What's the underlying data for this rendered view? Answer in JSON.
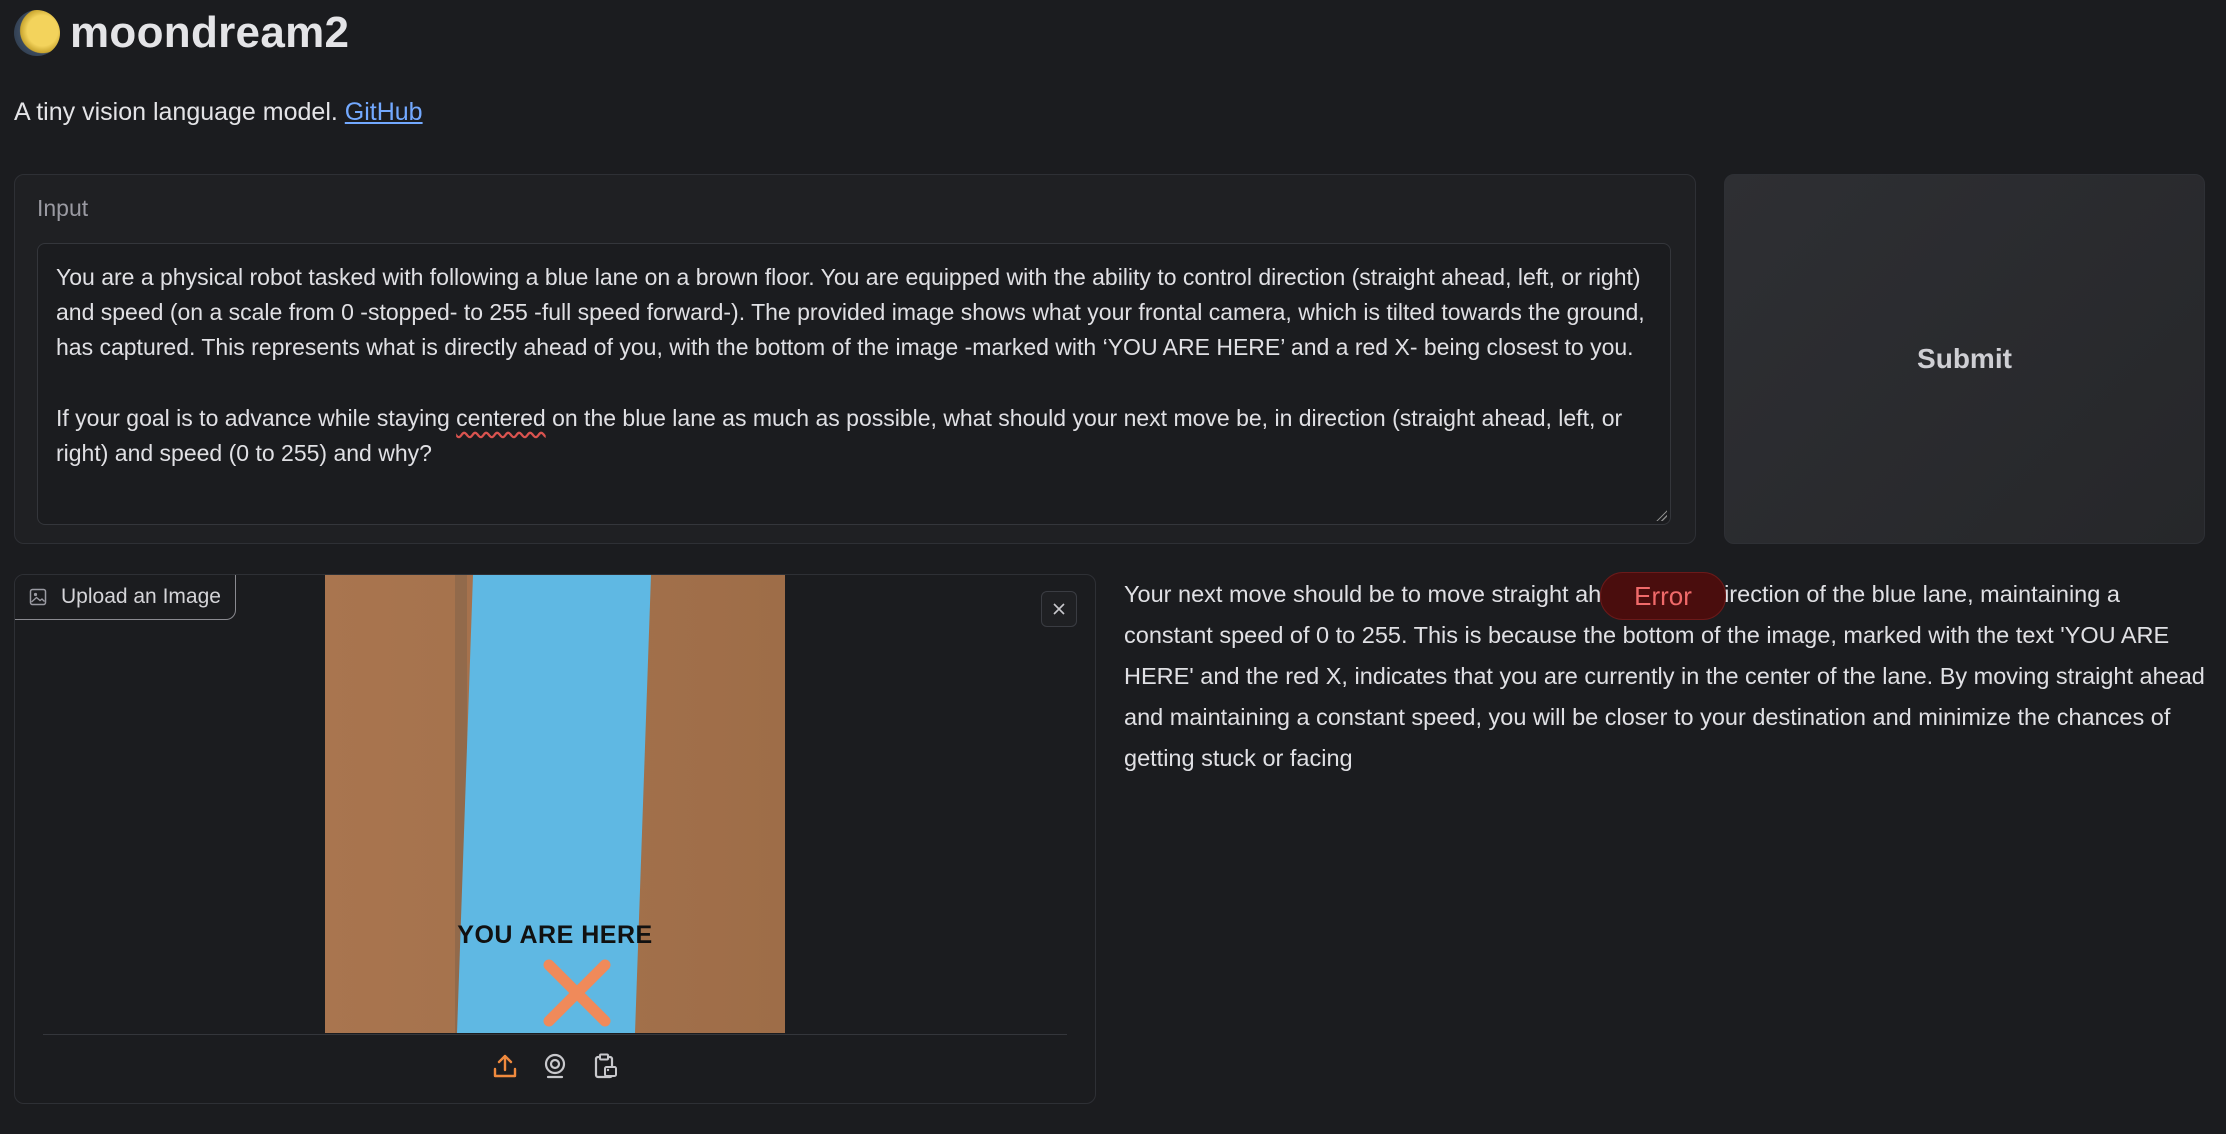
{
  "app": {
    "title": "moondream2",
    "subtitle": "A tiny vision language model.",
    "github_link": "GitHub"
  },
  "input": {
    "label": "Input",
    "prompt_paragraph_1": "You are a physical robot tasked with following a blue lane on a brown floor. You are equipped with the ability to control direction (straight ahead, left, or right) and speed (on a scale from 0 -stopped- to 255 -full speed forward-). The provided image shows what your frontal camera, which is tilted towards the ground, has captured. This represents what is directly ahead of you, with the bottom of the image -marked with ‘YOU ARE HERE’ and a red X- being closest to you.",
    "prompt_paragraph_2_before": "If your goal is to advance while staying ",
    "prompt_paragraph_2_flagged": "centered",
    "prompt_paragraph_2_after": " on the blue lane as much as possible, what should your next move be, in direction (straight ahead, left, or right) and speed  (0 to 255) and why?"
  },
  "submit_label": "Submit",
  "image_input": {
    "upload_label": "Upload an Image",
    "image_caption": "YOU ARE HERE",
    "tools": [
      "upload-icon",
      "webcam-icon",
      "clipboard-icon"
    ]
  },
  "output": {
    "text": "Your next move should be to move straight ahead in the direction of the blue lane, maintaining a constant speed of 0 to 255. This is because the bottom of the image, marked with the text 'YOU ARE HERE' and the red X, indicates that you are currently in the center of the lane. By moving straight ahead and maintaining a constant speed, you will be closer to your destination and minimize the chances of getting stuck or facing",
    "error_label": "Error"
  },
  "colors": {
    "background": "#1b1c1f",
    "link": "#73a9ff",
    "accent_orange": "#f08a3e",
    "error": "#f06a6a"
  }
}
